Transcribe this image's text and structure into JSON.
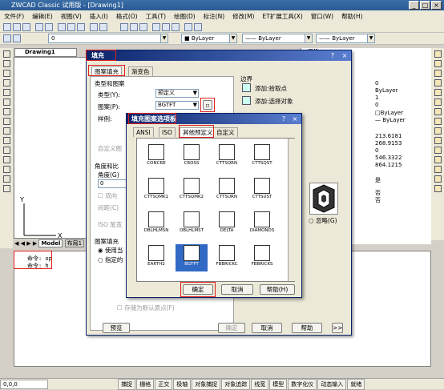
{
  "window": {
    "title": "ZWCAD Classic 试用版 - [Drawing1]"
  },
  "menu": [
    "文件(F)",
    "编辑(E)",
    "视图(V)",
    "插入(I)",
    "格式(O)",
    "工具(T)",
    "绘图(D)",
    "标注(N)",
    "修改(M)",
    "ET扩展工具(X)",
    "窗口(W)",
    "帮助(H)"
  ],
  "toolbar": {
    "layer_value": "0",
    "color_value": "ByLayer",
    "linetype_value": "ByLayer",
    "lineweight_value": "ByLayer"
  },
  "drawing_tab": "Drawing1",
  "props_header": "属性",
  "props_values": [
    "0",
    "ByLayer",
    "1",
    "0",
    "□ByLayer",
    "— ByLayer",
    "213.6181",
    "268.9153",
    "0",
    "546.3322",
    "864.1215",
    "是",
    "否",
    "否"
  ],
  "layout_tabs": [
    "Model",
    "布局1"
  ],
  "command_lines": [
    "命令: op",
    "命令: h"
  ],
  "status_items": [
    "捕捉",
    "栅格",
    "正交",
    "极轴",
    "对象捕捉",
    "对象追踪",
    "线宽",
    "模型",
    "数字化仪",
    "动态输入",
    "就绪"
  ],
  "status_coord": "0,0,0",
  "hatch": {
    "title": "填充",
    "tab_pattern": "图案填充",
    "tab_gradient": "渐变色",
    "group_type": "类型和图案",
    "type_label": "类型(Y):",
    "type_value": "预定义",
    "pattern_label": "图案(P):",
    "pattern_value": "BGTFT",
    "swatch_label": "样例:",
    "custom_label": "自定义图",
    "angle_group": "角度和比",
    "angle_label": "角度(G)",
    "angle_value": "0",
    "double_label": "双向",
    "spacing_label": "间距(C)",
    "iso_label": "ISO 笔宽",
    "origin_group": "图案填充",
    "use_current": "使用当",
    "specify": "指定的",
    "store_default": "存储为默认原点(F)",
    "border_group": "边界",
    "add_pick": "添加:拾取点",
    "add_select": "添加:选择对象",
    "island_opt": "忽略(G)",
    "btn_preview": "预览",
    "btn_ok": "确定",
    "btn_cancel": "取消",
    "btn_help": "帮助",
    "btn_more": ">>"
  },
  "palette": {
    "title": "填充图案选项板",
    "tabs": [
      "ANSI",
      "ISO",
      "其他预定义",
      "自定义"
    ],
    "patterns": [
      "CONCRE",
      "CROSS",
      "CTTSQRN",
      "CTTSQST",
      "CTTSQMK1",
      "CTTSQMK2",
      "CTTSURN",
      "CTTSUST",
      "DBLHLMSN",
      "DBLHLMST",
      "DELTA",
      "DIAMONDS",
      "EARTH2",
      "BGTFT",
      "FBBRICKC",
      "FBBRICKS"
    ],
    "btn_ok": "确定",
    "btn_cancel": "取消",
    "btn_help": "帮助(H)"
  },
  "colors": {
    "highlight": "#e0201c",
    "title_bar": "#0a246a"
  }
}
